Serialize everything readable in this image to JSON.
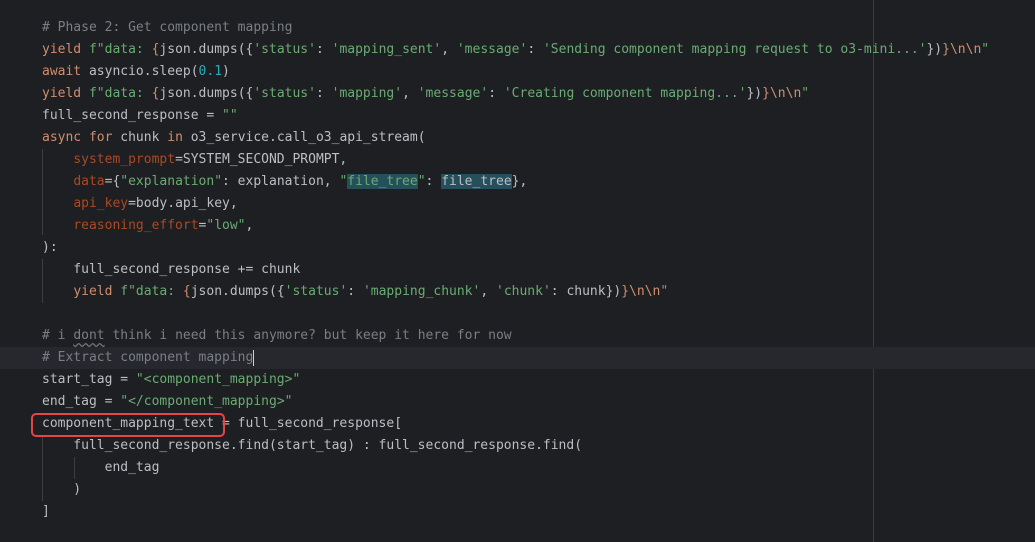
{
  "editor": {
    "lines": [
      [
        {
          "t": "# Phase 2: Get component mapping",
          "c": "cm"
        }
      ],
      [
        {
          "t": "yield ",
          "c": "kw"
        },
        {
          "t": "f\"data: ",
          "c": "str"
        },
        {
          "t": "{",
          "c": "fbr"
        },
        {
          "t": "json.dumps({",
          "c": "pl"
        },
        {
          "t": "'status'",
          "c": "str"
        },
        {
          "t": ": ",
          "c": "pl"
        },
        {
          "t": "'mapping_sent'",
          "c": "str"
        },
        {
          "t": ", ",
          "c": "pl"
        },
        {
          "t": "'message'",
          "c": "str"
        },
        {
          "t": ": ",
          "c": "pl"
        },
        {
          "t": "'Sending component mapping request to o3-mini...'",
          "c": "str"
        },
        {
          "t": "})",
          "c": "pl"
        },
        {
          "t": "}",
          "c": "fbr"
        },
        {
          "t": "\\n\\n",
          "c": "esc"
        },
        {
          "t": "\"",
          "c": "str"
        }
      ],
      [
        {
          "t": "await ",
          "c": "kw"
        },
        {
          "t": "asyncio.sleep(",
          "c": "pl"
        },
        {
          "t": "0.1",
          "c": "num"
        },
        {
          "t": ")",
          "c": "pl"
        }
      ],
      [
        {
          "t": "yield ",
          "c": "kw"
        },
        {
          "t": "f\"data: ",
          "c": "str"
        },
        {
          "t": "{",
          "c": "fbr"
        },
        {
          "t": "json.dumps({",
          "c": "pl"
        },
        {
          "t": "'status'",
          "c": "str"
        },
        {
          "t": ": ",
          "c": "pl"
        },
        {
          "t": "'mapping'",
          "c": "str"
        },
        {
          "t": ", ",
          "c": "pl"
        },
        {
          "t": "'message'",
          "c": "str"
        },
        {
          "t": ": ",
          "c": "pl"
        },
        {
          "t": "'Creating component mapping...'",
          "c": "str"
        },
        {
          "t": "})",
          "c": "pl"
        },
        {
          "t": "}",
          "c": "fbr"
        },
        {
          "t": "\\n\\n",
          "c": "esc"
        },
        {
          "t": "\"",
          "c": "str"
        }
      ],
      [
        {
          "t": "full_second_response = ",
          "c": "pl"
        },
        {
          "t": "\"\"",
          "c": "str"
        }
      ],
      [
        {
          "t": "async for ",
          "c": "kw"
        },
        {
          "t": "chunk ",
          "c": "pl"
        },
        {
          "t": "in ",
          "c": "kw"
        },
        {
          "t": "o3_service.call_o3_api_stream(",
          "c": "pl"
        }
      ],
      [
        {
          "t": "    ",
          "c": "pl"
        },
        {
          "t": "system_prompt",
          "c": "param"
        },
        {
          "t": "=SYSTEM_SECOND_PROMPT,",
          "c": "pl"
        }
      ],
      [
        {
          "t": "    ",
          "c": "pl"
        },
        {
          "t": "data",
          "c": "param"
        },
        {
          "t": "={",
          "c": "pl"
        },
        {
          "t": "\"explanation\"",
          "c": "str"
        },
        {
          "t": ": explanation, ",
          "c": "pl"
        },
        {
          "t": "\"",
          "c": "str"
        },
        {
          "t": "file_tree",
          "c": "str hl"
        },
        {
          "t": "\"",
          "c": "str"
        },
        {
          "t": ": ",
          "c": "pl"
        },
        {
          "t": "file_tree",
          "c": "pl hl"
        },
        {
          "t": "},",
          "c": "pl"
        }
      ],
      [
        {
          "t": "    ",
          "c": "pl"
        },
        {
          "t": "api_key",
          "c": "param"
        },
        {
          "t": "=body.api_key,",
          "c": "pl"
        }
      ],
      [
        {
          "t": "    ",
          "c": "pl"
        },
        {
          "t": "reasoning_effort",
          "c": "param"
        },
        {
          "t": "=",
          "c": "pl"
        },
        {
          "t": "\"low\"",
          "c": "str"
        },
        {
          "t": ",",
          "c": "pl"
        }
      ],
      [
        {
          "t": "):",
          "c": "pl"
        }
      ],
      [
        {
          "t": "    full_second_response += chunk",
          "c": "pl"
        }
      ],
      [
        {
          "t": "    ",
          "c": "pl"
        },
        {
          "t": "yield ",
          "c": "kw"
        },
        {
          "t": "f\"data: ",
          "c": "str"
        },
        {
          "t": "{",
          "c": "fbr"
        },
        {
          "t": "json.dumps({",
          "c": "pl"
        },
        {
          "t": "'status'",
          "c": "str"
        },
        {
          "t": ": ",
          "c": "pl"
        },
        {
          "t": "'mapping_chunk'",
          "c": "str"
        },
        {
          "t": ", ",
          "c": "pl"
        },
        {
          "t": "'chunk'",
          "c": "str"
        },
        {
          "t": ": chunk})",
          "c": "pl"
        },
        {
          "t": "}",
          "c": "fbr"
        },
        {
          "t": "\\n\\n",
          "c": "esc"
        },
        {
          "t": "\"",
          "c": "str"
        }
      ],
      [],
      [
        {
          "t": "# i ",
          "c": "cm"
        },
        {
          "t": "dont",
          "c": "cm ul"
        },
        {
          "t": " think i need this anymore? but keep it here for now",
          "c": "cm"
        }
      ],
      [
        {
          "t": "# Extract component mapping",
          "c": "cm"
        }
      ],
      [
        {
          "t": "start_tag = ",
          "c": "pl"
        },
        {
          "t": "\"<component_mapping>\"",
          "c": "str"
        }
      ],
      [
        {
          "t": "end_tag = ",
          "c": "pl"
        },
        {
          "t": "\"</component_mapping>\"",
          "c": "str"
        }
      ],
      [
        {
          "t": "component_mapping_text",
          "c": "pl"
        },
        {
          "t": " = full_second_response[",
          "c": "pl"
        }
      ],
      [
        {
          "t": "    full_second_response.find(start_tag) : full_second_response.find(",
          "c": "pl"
        }
      ],
      [
        {
          "t": "        end_tag",
          "c": "pl"
        }
      ],
      [
        {
          "t": "    )",
          "c": "pl"
        }
      ],
      [
        {
          "t": "]",
          "c": "pl"
        }
      ]
    ]
  }
}
